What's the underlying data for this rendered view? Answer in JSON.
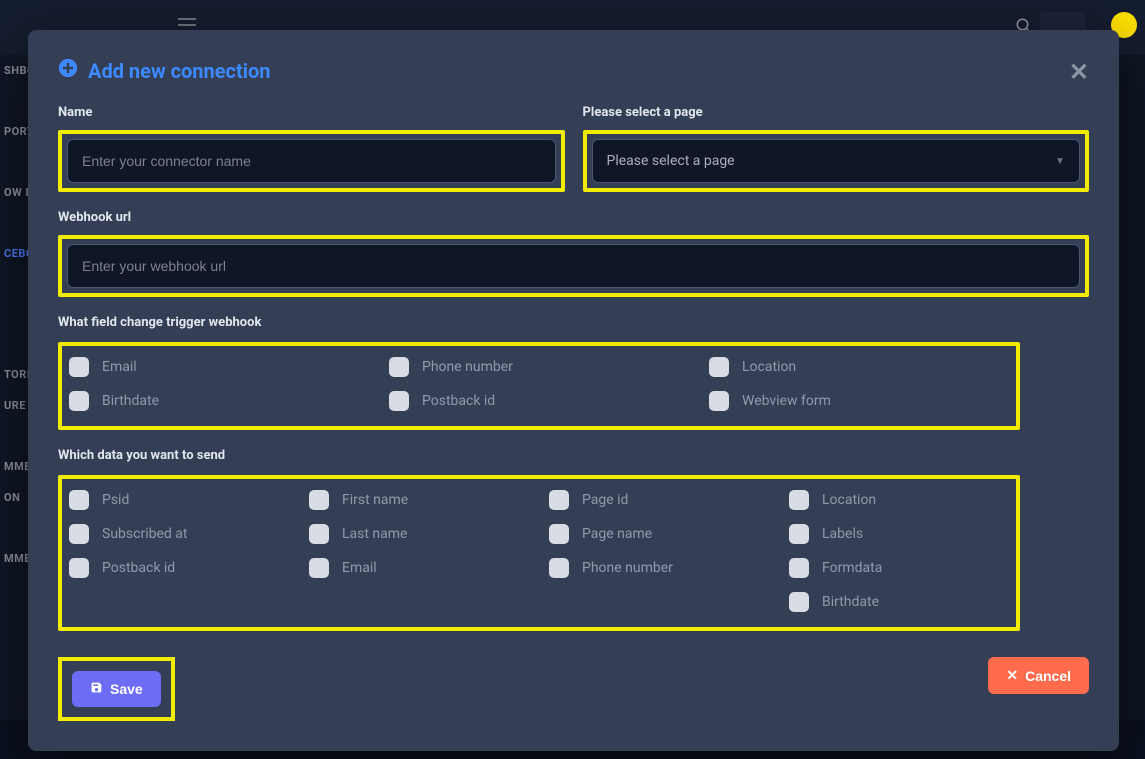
{
  "bg": {
    "sidebar": [
      "SHBC",
      "PORT",
      "OW B",
      "CEBC",
      "TORIA",
      "URE",
      "MMEN",
      "ON",
      "MMENT"
    ]
  },
  "modal": {
    "title": "Add new connection",
    "name_label": "Name",
    "name_placeholder": "Enter your connector name",
    "page_label": "Please select a page",
    "page_placeholder": "Please select a page",
    "webhook_label": "Webhook url",
    "webhook_placeholder": "Enter your webhook url",
    "trigger_label": "What field change trigger webhook",
    "triggers": [
      "Email",
      "Phone number",
      "Location",
      "Birthdate",
      "Postback id",
      "Webview form"
    ],
    "send_label": "Which data you want to send",
    "send_fields": [
      "Psid",
      "First name",
      "Page id",
      "Location",
      "Subscribed at",
      "Last name",
      "Page name",
      "Labels",
      "Postback id",
      "Email",
      "Phone number",
      "Formdata",
      "",
      "",
      "",
      "Birthdate"
    ],
    "save": "Save",
    "cancel": "Cancel"
  }
}
